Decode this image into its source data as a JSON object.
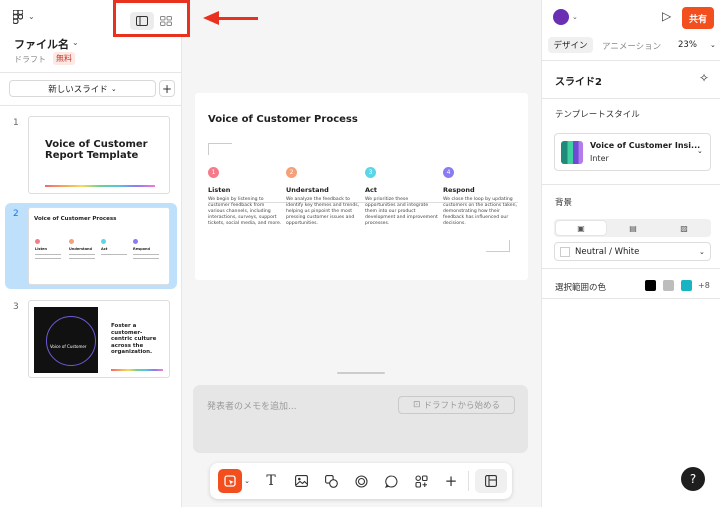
{
  "header": {
    "file_name": "ファイル名",
    "draft_label": "ドラフト",
    "plan_badge": "無料",
    "logo_icon": "figma-logo-icon",
    "view_toggle": {
      "active": "single-view-icon",
      "other": "grid-view-icon"
    }
  },
  "slides_panel": {
    "new_slide_label": "新しいスライド",
    "add_label": "+",
    "slides": [
      {
        "number": "1",
        "title": "Voice of Customer Report Template"
      },
      {
        "number": "2",
        "title": "Voice of Customer Process"
      },
      {
        "number": "3",
        "dark_label": "Voice of Customer",
        "title": "Foster a customer-centric culture across the organization."
      }
    ]
  },
  "canvas": {
    "title": "Voice of Customer Process",
    "steps": [
      {
        "num": "1",
        "color": "#f47c8a",
        "heading": "Listen",
        "text": "We begin by listening to customer feedback from various channels, including interactions, surveys, support tickets, social media, and more."
      },
      {
        "num": "2",
        "color": "#f5a07a",
        "heading": "Understand",
        "text": "We analyze the feedback to identify key themes and trends, helping us pinpoint the most pressing customer issues and opportunities."
      },
      {
        "num": "3",
        "color": "#5bd6e8",
        "heading": "Act",
        "text": "We prioritize these opportunities and integrate them into our product development and improvement processes."
      },
      {
        "num": "4",
        "color": "#8b7bf2",
        "heading": "Respond",
        "text": "We close the loop by updating customers on the actions taken, demonstrating how their feedback has influenced our decisions."
      }
    ]
  },
  "notes": {
    "placeholder": "発表者のメモを追加...",
    "draft_button": "ドラフトから始める"
  },
  "toolbar": {
    "tools": [
      "select-frame-icon",
      "text-icon",
      "image-icon",
      "shape-icon",
      "stamp-icon",
      "comment-icon",
      "widgets-icon",
      "plus-icon",
      "layout-icon"
    ],
    "text_tool": "T",
    "plus": "+"
  },
  "right_panel": {
    "share_label": "共有",
    "tabs": {
      "design": "デザイン",
      "animation": "アニメーション"
    },
    "zoom": "23%",
    "slide_name": "スライド2",
    "template_style_label": "テンプレートスタイル",
    "template": {
      "name": "Voice of Customer Insi...",
      "font": "Inter"
    },
    "background_label": "背景",
    "background_value": "Neutral / White",
    "selection_colors_label": "選択範囲の色",
    "selection_colors": [
      "#000000",
      "#bdbdbd",
      "#1ab3c4"
    ],
    "more_colors": "+8",
    "help_label": "?"
  }
}
